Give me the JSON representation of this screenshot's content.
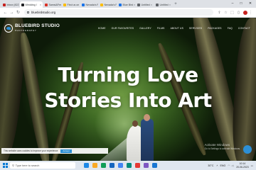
{
  "browser": {
    "tabs": [
      {
        "label": "Inbox (822)",
        "color": "#c5221f",
        "active": false
      },
      {
        "label": "Wedding I",
        "color": "#202124",
        "active": true
      },
      {
        "label": "Samsi&Fee",
        "color": "#d93025",
        "active": false
      },
      {
        "label": "Find us on",
        "color": "#fbbc04",
        "active": false
      },
      {
        "label": "Nevada's R",
        "color": "#1a73e8",
        "active": false
      },
      {
        "label": "Nevada's P",
        "color": "#fbbc04",
        "active": false
      },
      {
        "label": "Blue Bird",
        "color": "#1a73e8",
        "active": false
      },
      {
        "label": "Untitled",
        "color": "#5f6368",
        "active": false
      },
      {
        "label": "Untitled",
        "color": "#5f6368",
        "active": false
      }
    ],
    "url": "bluebirdstudio.org"
  },
  "site": {
    "logo_name": "BLUEBIRD STUDIO",
    "logo_sub": "PHOTOGRAPHY",
    "nav": [
      "HOME",
      "OUR FAVOURITES",
      "GALLERY",
      "FILMS",
      "ABOUT US",
      "SERVICES",
      "PACKAGES",
      "FAQ",
      "CONTACT"
    ],
    "headline_line1": "Turning Love",
    "headline_line2": "Stories Into Art",
    "cookie_text": "This website uses cookies to improve your experience",
    "cookie_accept": "Accept",
    "watermark_title": "Activate Windows",
    "watermark_sub": "Go to Settings to activate Windows."
  },
  "taskbar": {
    "search_placeholder": "Type here to search",
    "weather": "30°C",
    "lang": "ENG",
    "time": "10:14",
    "date": "20-06-2023",
    "icon_colors": [
      "#1e88e5",
      "#f9a825",
      "#0f9d58",
      "#1565c0",
      "#4285f4",
      "#00897b",
      "#e53935",
      "#7e57c2",
      "#1976d2"
    ]
  }
}
